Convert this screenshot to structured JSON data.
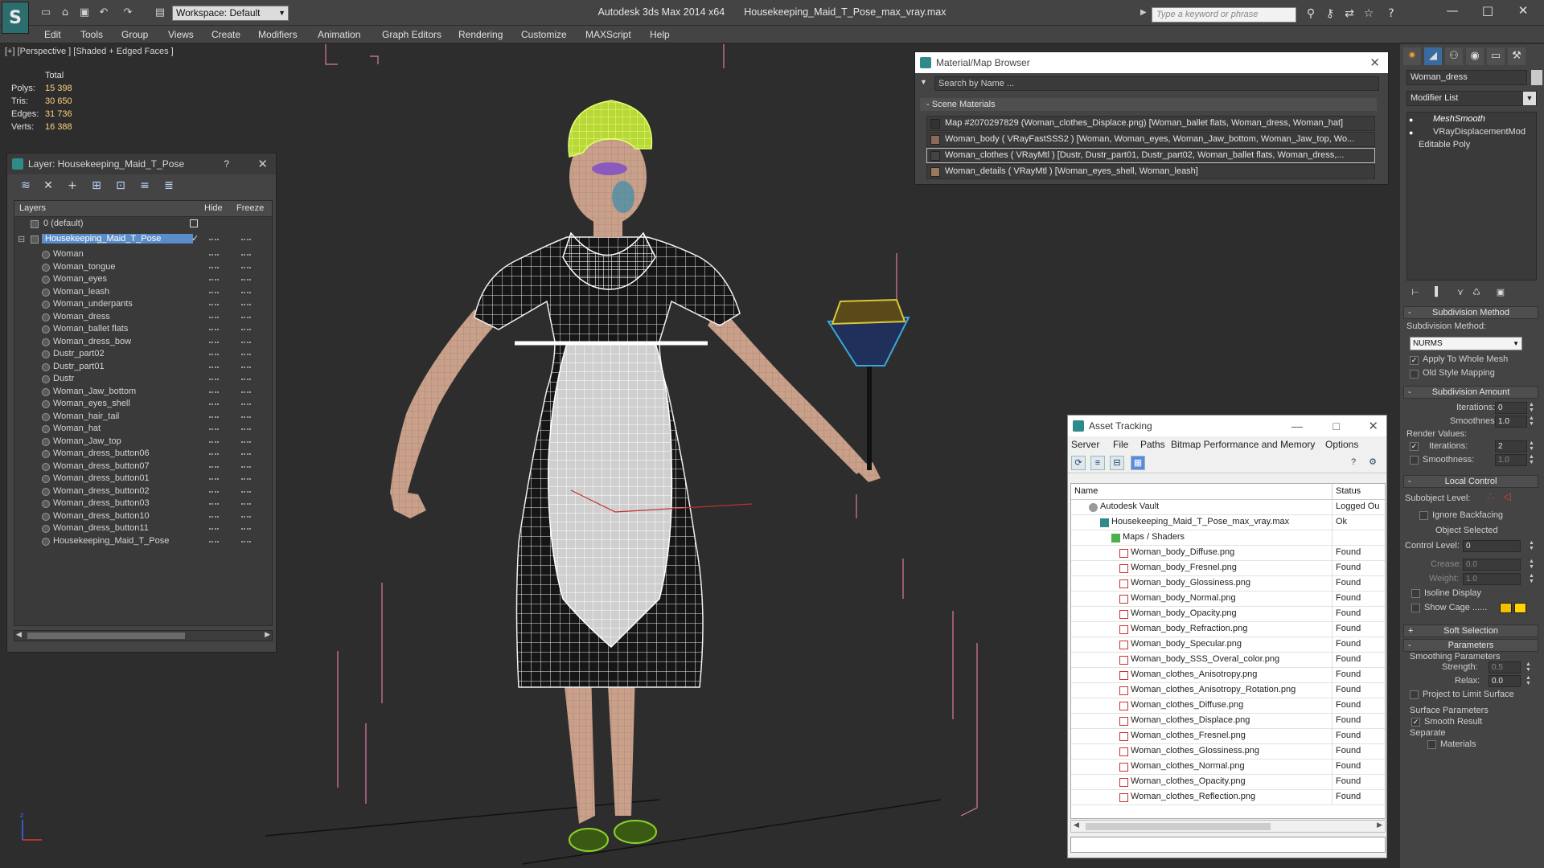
{
  "titlebar": {
    "workspace": "Workspace: Default",
    "app_name": "Autodesk 3ds Max  2014 x64",
    "file_name": "Housekeeping_Maid_T_Pose_max_vray.max",
    "search_placeholder": "Type a keyword or phrase",
    "logo_letter": "S"
  },
  "menu": [
    "Edit",
    "Tools",
    "Group",
    "Views",
    "Create",
    "Modifiers",
    "Animation",
    "Graph Editors",
    "Rendering",
    "Customize",
    "MAXScript",
    "Help"
  ],
  "viewport": {
    "label": "[+] [Perspective ] [Shaded + Edged Faces ]",
    "stats_header": "Total",
    "stats": [
      {
        "k": "Polys:",
        "v": "15 398"
      },
      {
        "k": "Tris:",
        "v": "30 650"
      },
      {
        "k": "Edges:",
        "v": "31 736"
      },
      {
        "k": "Verts:",
        "v": "16 388"
      }
    ]
  },
  "layer_panel": {
    "title": "Layer: Housekeeping_Maid_T_Pose",
    "help": "?",
    "col_layers": "Layers",
    "col_hide": "Hide",
    "col_freeze": "Freeze",
    "default_layer": "0 (default)",
    "active_layer": "Housekeeping_Maid_T_Pose",
    "objects": [
      "Woman",
      "Woman_tongue",
      "Woman_eyes",
      "Woman_leash",
      "Woman_underpants",
      "Woman_dress",
      "Woman_ballet flats",
      "Woman_dress_bow",
      "Dustr_part02",
      "Dustr_part01",
      "Dustr",
      "Woman_Jaw_bottom",
      "Woman_eyes_shell",
      "Woman_hair_tail",
      "Woman_hat",
      "Woman_Jaw_top",
      "Woman_dress_button06",
      "Woman_dress_button07",
      "Woman_dress_button01",
      "Woman_dress_button02",
      "Woman_dress_button03",
      "Woman_dress_button10",
      "Woman_dress_button11",
      "Housekeeping_Maid_T_Pose"
    ]
  },
  "material_browser": {
    "title": "Material/Map Browser",
    "search": "Search by Name ...",
    "section": "Scene Materials",
    "rows": [
      "Map #2070297829 (Woman_clothes_Displace.png) [Woman_ballet flats, Woman_dress, Woman_hat]",
      "Woman_body  ( VRayFastSSS2 ) [Woman, Woman_eyes, Woman_Jaw_bottom, Woman_Jaw_top, Wo...",
      "Woman_clothes  ( VRayMtl ) [Dustr, Dustr_part01, Dustr_part02, Woman_ballet flats, Woman_dress,...",
      "Woman_details  ( VRayMtl ) [Woman_eyes_shell, Woman_leash]"
    ]
  },
  "asset_tracking": {
    "title": "Asset Tracking",
    "menu": [
      "Server",
      "File",
      "Paths",
      "Bitmap Performance and Memory",
      "Options"
    ],
    "col_name": "Name",
    "col_status": "Status",
    "vault": {
      "name": "Autodesk Vault",
      "status": "Logged Ou"
    },
    "file": {
      "name": "Housekeeping_Maid_T_Pose_max_vray.max",
      "status": "Ok"
    },
    "maps_folder": "Maps / Shaders",
    "maps": [
      {
        "name": "Woman_body_Diffuse.png",
        "status": "Found"
      },
      {
        "name": "Woman_body_Fresnel.png",
        "status": "Found"
      },
      {
        "name": "Woman_body_Glossiness.png",
        "status": "Found"
      },
      {
        "name": "Woman_body_Normal.png",
        "status": "Found"
      },
      {
        "name": "Woman_body_Opacity.png",
        "status": "Found"
      },
      {
        "name": "Woman_body_Refraction.png",
        "status": "Found"
      },
      {
        "name": "Woman_body_Specular.png",
        "status": "Found"
      },
      {
        "name": "Woman_body_SSS_Overal_color.png",
        "status": "Found"
      },
      {
        "name": "Woman_clothes_Anisotropy.png",
        "status": "Found"
      },
      {
        "name": "Woman_clothes_Anisotropy_Rotation.png",
        "status": "Found"
      },
      {
        "name": "Woman_clothes_Diffuse.png",
        "status": "Found"
      },
      {
        "name": "Woman_clothes_Displace.png",
        "status": "Found"
      },
      {
        "name": "Woman_clothes_Fresnel.png",
        "status": "Found"
      },
      {
        "name": "Woman_clothes_Glossiness.png",
        "status": "Found"
      },
      {
        "name": "Woman_clothes_Normal.png",
        "status": "Found"
      },
      {
        "name": "Woman_clothes_Opacity.png",
        "status": "Found"
      },
      {
        "name": "Woman_clothes_Reflection.png",
        "status": "Found"
      }
    ]
  },
  "command_panel": {
    "object_name": "Woman_dress",
    "modifier_list": "Modifier List",
    "stack": [
      "MeshSmooth",
      "VRayDisplacementMod",
      "Editable Poly"
    ],
    "subdivision_method": {
      "title": "Subdivision Method",
      "label": "Subdivision Method:",
      "value": "NURMS",
      "apply_whole_mesh": "Apply To Whole Mesh",
      "old_style": "Old Style Mapping"
    },
    "subdivision_amount": {
      "title": "Subdivision Amount",
      "iterations_label": "Iterations:",
      "iterations": "0",
      "smoothness_label": "Smoothness:",
      "smoothness": "1.0",
      "render_values": "Render Values:",
      "r_iterations_label": "Iterations:",
      "r_iterations": "2",
      "r_smoothness_label": "Smoothness:",
      "r_smoothness": "1.0"
    },
    "local_control": {
      "title": "Local Control",
      "subobject_level": "Subobject Level:",
      "ignore_backfacing": "Ignore Backfacing",
      "object_selected": "Object Selected",
      "control_level_label": "Control Level:",
      "control_level": "0",
      "crease_label": "Crease:",
      "crease": "0.0",
      "weight_label": "Weight:",
      "weight": "1.0",
      "isoline": "Isoline Display",
      "show_cage": "Show Cage ......"
    },
    "soft_selection": "Soft Selection",
    "parameters": {
      "title": "Parameters",
      "smoothing": "Smoothing Parameters",
      "strength_label": "Strength:",
      "strength": "0.5",
      "relax_label": "Relax:",
      "relax": "0.0",
      "project": "Project to Limit Surface",
      "surface": "Surface Parameters",
      "smooth_result": "Smooth Result",
      "separate": "Separate",
      "materials": "Materials"
    }
  },
  "colors": {
    "selection": "#5b8ec8",
    "stat_value": "#ffd27a",
    "cage_color_1": "#f0c000",
    "cage_color_2": "#ffd200"
  }
}
